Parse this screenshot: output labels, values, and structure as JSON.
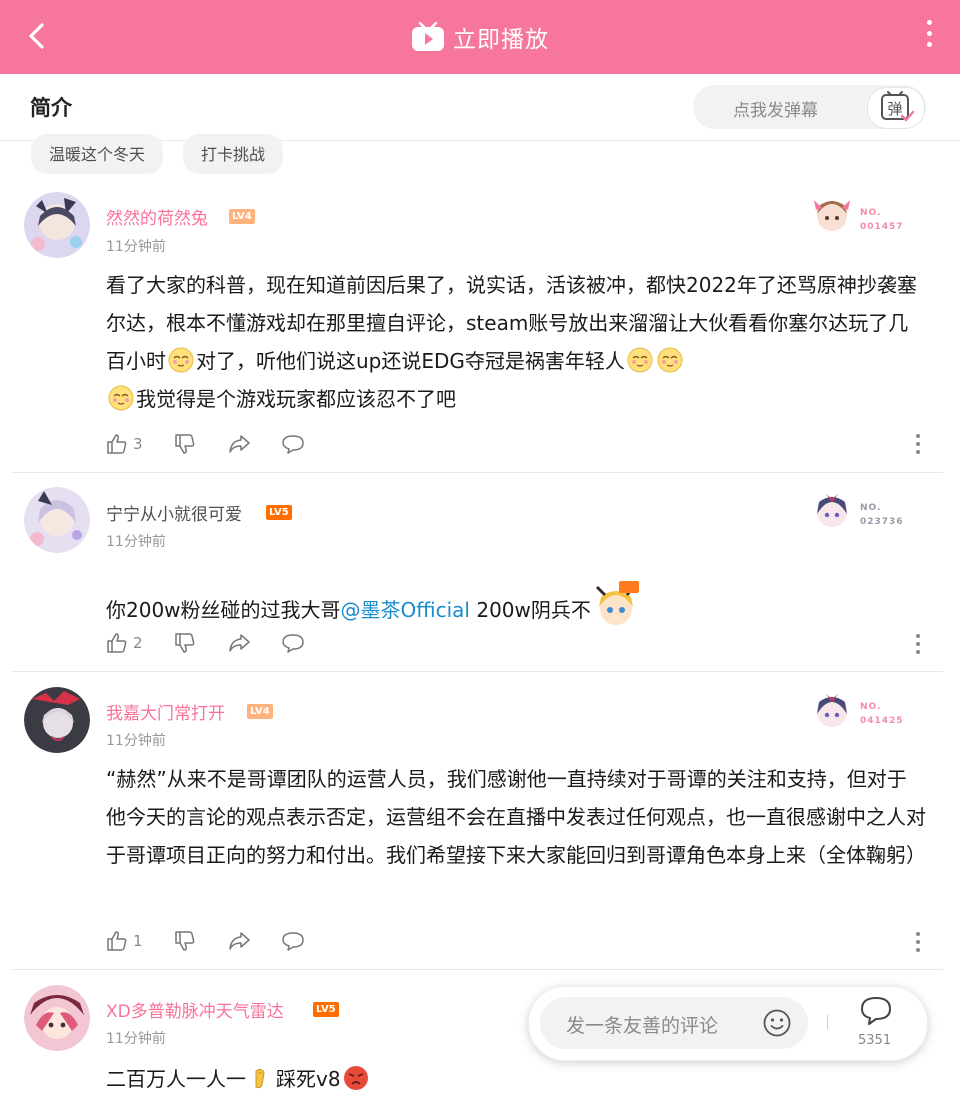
{
  "colors": {
    "accent": "#f7779c",
    "username_pink": "#fb7299",
    "mention": "#178bcf"
  },
  "topbar": {
    "title": "立即播放",
    "icons": [
      "back-icon",
      "tv-icon",
      "more-icon"
    ]
  },
  "tabrow": {
    "intro_tab": "简介",
    "danmaku_placeholder": "点我发弹幕",
    "danmaku_button_icon": "danmaku-icon",
    "danmaku_button_text": "弹"
  },
  "tags": [
    "温暖这个冬天",
    "打卡挑战"
  ],
  "comments": [
    {
      "username": "然然的荷然兔",
      "level": "LV4",
      "time": "11分钟前",
      "fan_no_label": "NO.",
      "fan_no": "001457",
      "text_1": "看了大家的科普，现在知道前因后果了，说实话，活该被冲，都快2022年了还骂原神抄袭塞尔达，根本不懂游戏却在那里擅自评论，steam账号放出来溜溜让大伙看看你塞尔达玩了几百小时",
      "text_2": "对了，听他们说这up还说EDG夺冠是祸害年轻人",
      "text_3": "我觉得是个游戏玩家都应该忍不了吧",
      "likes": "3"
    },
    {
      "username": "宁宁从小就很可爱",
      "level": "LV5",
      "time": "11分钟前",
      "fan_no_label": "NO.",
      "fan_no": "023736",
      "text_1": "你200w粉丝碰的过我大哥",
      "mention": "@墨茶Official",
      "text_2": " 200w阴兵不",
      "likes": "2"
    },
    {
      "username": "我嘉大门常打开",
      "level": "LV4",
      "time": "11分钟前",
      "fan_no_label": "NO.",
      "fan_no": "041425",
      "text_1": "“赫然”从来不是哥谭团队的运营人员，我们感谢他一直持续对于哥谭的关注和支持，但对于他今天的言论的观点表示否定，运营组不会在直播中发表过任何观点，也一直很感谢中之人对于哥谭项目正向的努力和付出。我们希望接下来大家能回归到哥谭角色本身上来（全体鞠躬）",
      "likes": "1"
    },
    {
      "username": "XD多普勒脉冲天气雷达",
      "level": "LV5",
      "time": "11分钟前",
      "text_1": "二百万人一人一",
      "text_2": "踩死v8"
    }
  ],
  "comment_bar": {
    "placeholder": "发一条友善的评论",
    "count": "5351",
    "emoji_icon": "smile-icon",
    "comment_icon": "comment-icon"
  }
}
